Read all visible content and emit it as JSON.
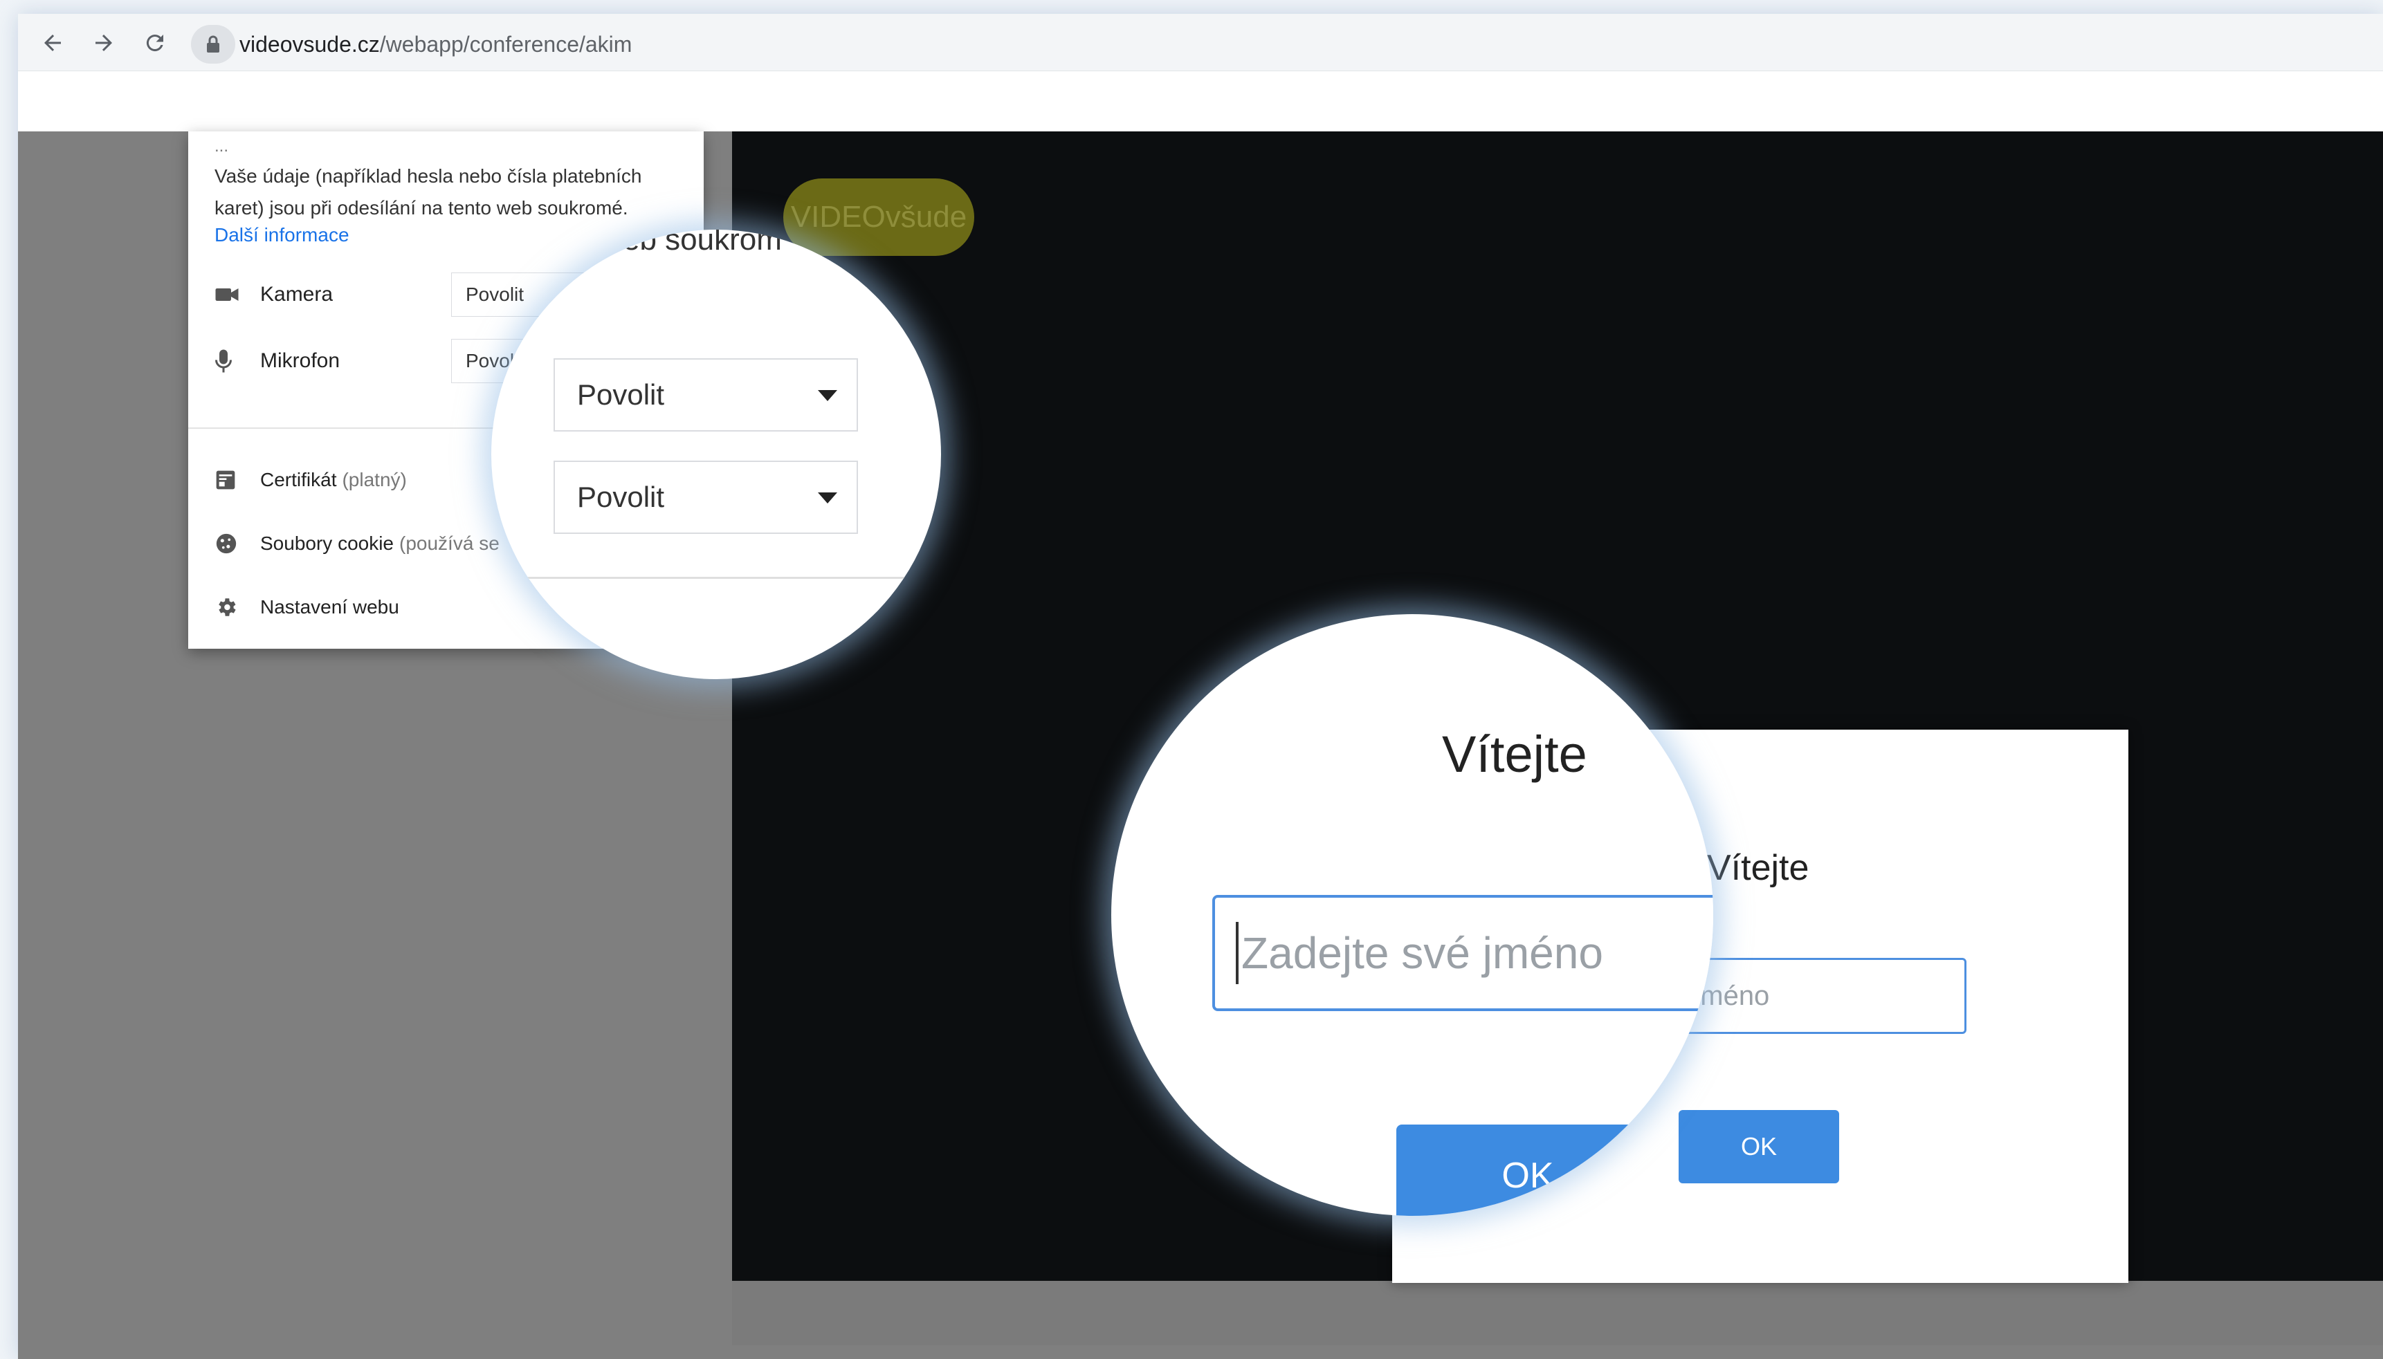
{
  "browser": {
    "url_host": "videovsude.cz",
    "url_path": "/webapp/conference/akim"
  },
  "site_info": {
    "top_line": "...",
    "description": "Vaše údaje (například hesla nebo čísla platebních karet) jsou při odesílání na tento web soukromé.",
    "more_info_link": "Další informace",
    "permissions": [
      {
        "label": "Kamera",
        "value": "Povolit"
      },
      {
        "label": "Mikrofon",
        "value": "Povol"
      }
    ],
    "menu": [
      {
        "label": "Certifikát",
        "sub": "(platný)"
      },
      {
        "label": "Soubory cookie",
        "sub": "(používá se"
      },
      {
        "label": "Nastavení webu",
        "sub": ""
      }
    ]
  },
  "magnifier_top": {
    "partial_text": "eb soukrom",
    "select_1": "Povolit",
    "select_2": "Povolit"
  },
  "app": {
    "logo": "VIDEOvšude",
    "dialog_title": "Vítejte",
    "name_placeholder_partial": "é jméno",
    "ok_label": "OK"
  },
  "magnifier_bottom": {
    "title": "Vítejte",
    "name_placeholder": "Zadejte své jméno",
    "ok_label": "OK"
  },
  "colors": {
    "accent_blue": "#3d8be1",
    "link_blue": "#1a73e8",
    "video_bg": "#0c0e10",
    "logo_bg": "#6b6a16"
  }
}
